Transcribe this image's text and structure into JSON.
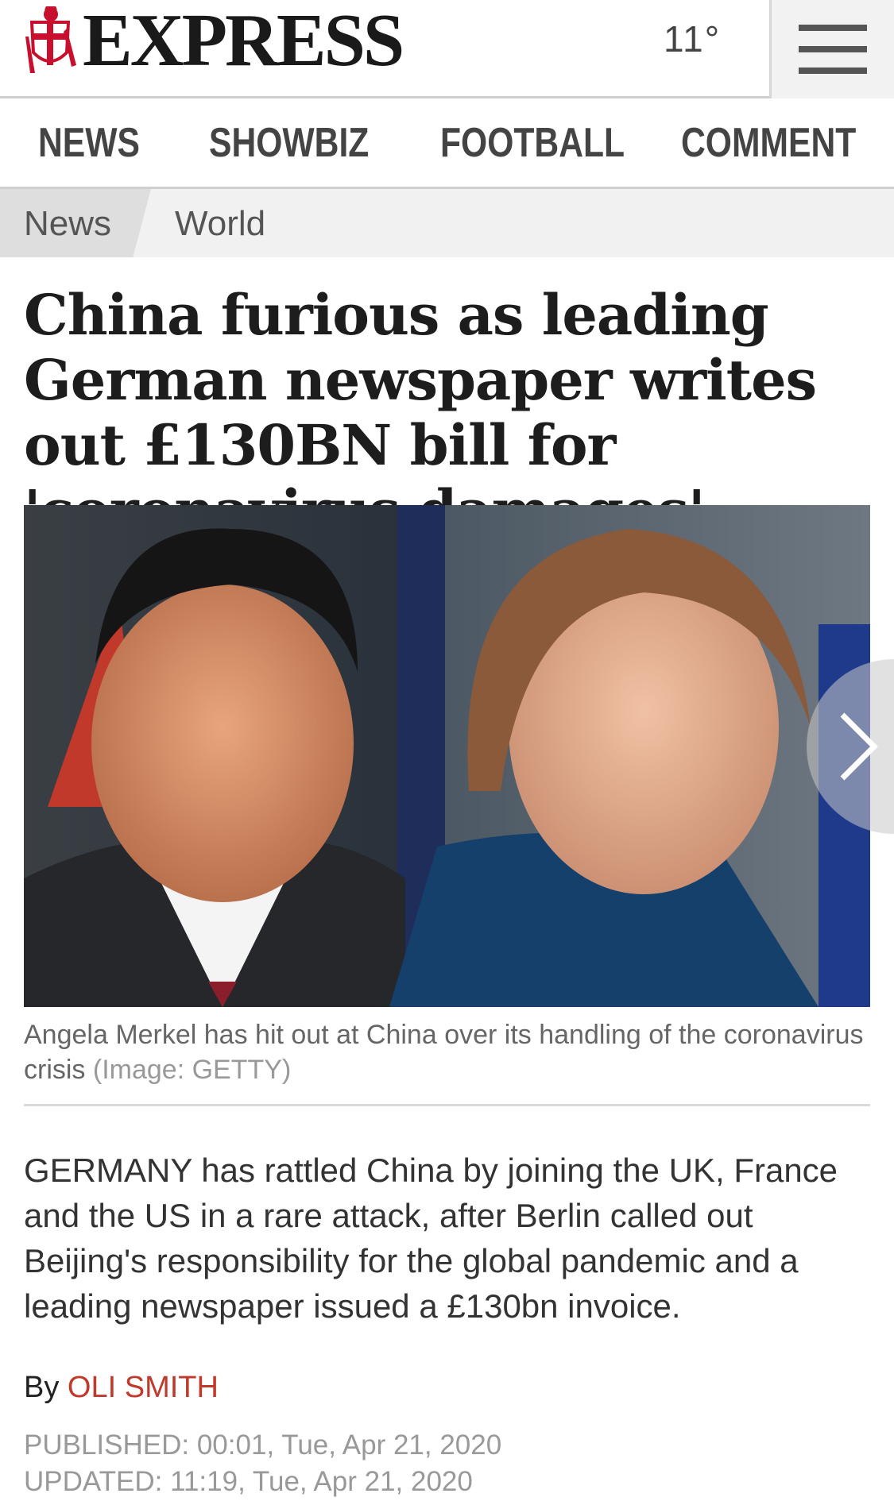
{
  "header": {
    "logo_text": "EXPRESS",
    "weather": "11°",
    "menu_icon": "hamburger-menu-icon"
  },
  "nav": {
    "items": [
      {
        "label": "NEWS"
      },
      {
        "label": "SHOWBIZ"
      },
      {
        "label": "FOOTBALL"
      },
      {
        "label": "COMMENT"
      }
    ]
  },
  "breadcrumb": {
    "section": "News",
    "subsection": "World"
  },
  "article": {
    "headline": "China furious as leading German newspaper writes out £130BN bill for 'coronavirus damages'",
    "image": {
      "caption": "Angela Merkel has hit out at China over its handling of the coronavirus crisis",
      "credit": "(Image: GETTY)",
      "next_icon": "chevron-right-icon"
    },
    "standfirst": "GERMANY has rattled China by joining the UK, France and the US in a rare attack, after Berlin called out Beijing's responsibility for the global pandemic and a leading newspaper issued a £130bn invoice.",
    "byline_prefix": "By",
    "author": "OLI SMITH",
    "published": "PUBLISHED: 00:01, Tue, Apr 21, 2020",
    "updated": "UPDATED: 11:19, Tue, Apr 21, 2020"
  },
  "colors": {
    "author_link": "#c0392b",
    "logo_red": "#c8102e"
  }
}
